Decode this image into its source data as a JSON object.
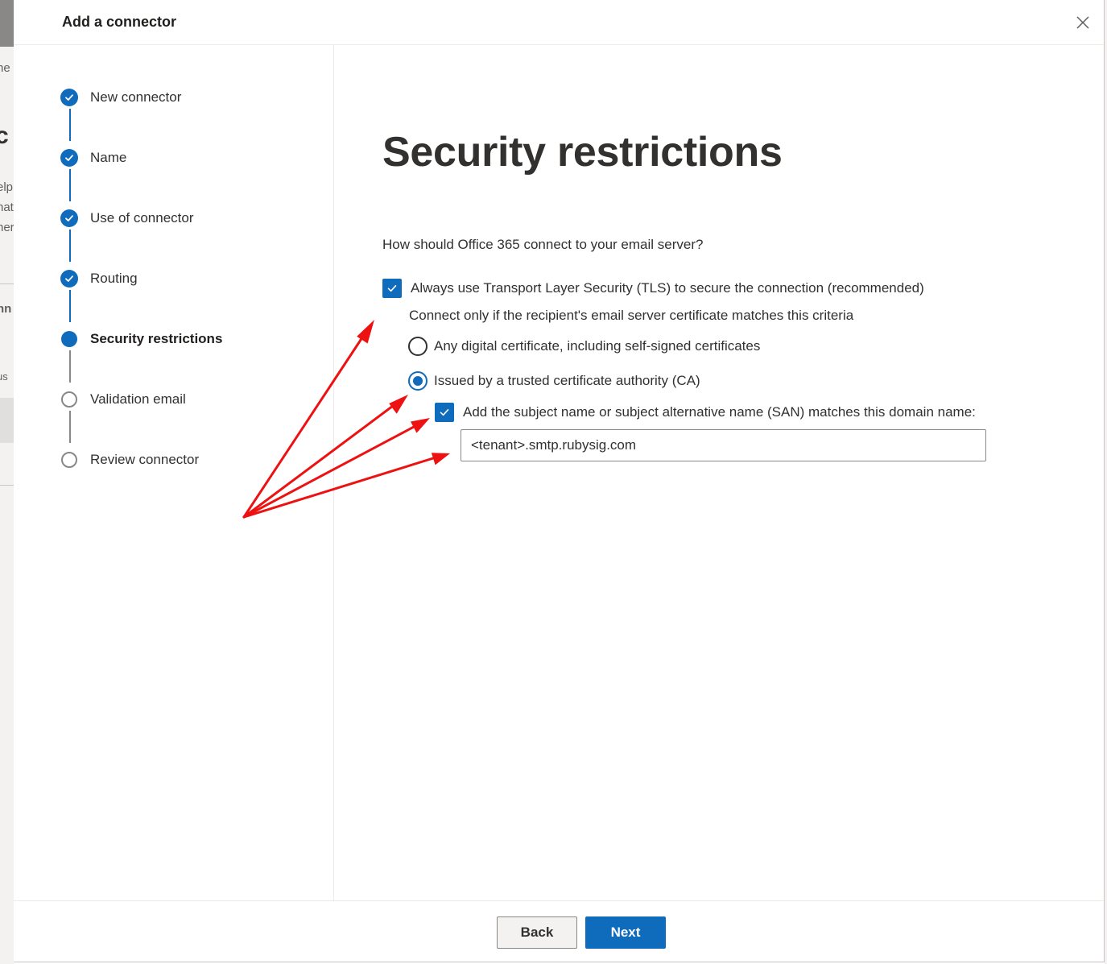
{
  "background": {
    "fragments": [
      "ne",
      "c",
      "elp",
      "nat",
      "her",
      "nn",
      "us"
    ]
  },
  "dialog": {
    "title": "Add a connector",
    "close_label": "Close"
  },
  "steps": [
    {
      "label": "New connector",
      "status": "completed"
    },
    {
      "label": "Name",
      "status": "completed"
    },
    {
      "label": "Use of connector",
      "status": "completed"
    },
    {
      "label": "Routing",
      "status": "completed"
    },
    {
      "label": "Security restrictions",
      "status": "current"
    },
    {
      "label": "Validation email",
      "status": "pending"
    },
    {
      "label": "Review connector",
      "status": "pending"
    }
  ],
  "content": {
    "title": "Security restrictions",
    "question": "How should Office 365 connect to your email server?",
    "tls_checkbox": {
      "label": "Always use Transport Layer Security (TLS) to secure the connection (recommended)",
      "checked": true
    },
    "criteria_text": "Connect only if the recipient's email server certificate matches this criteria",
    "radio_options": [
      {
        "label": "Any digital certificate, including self-signed certificates",
        "selected": false
      },
      {
        "label": "Issued by a trusted certificate authority (CA)",
        "selected": true
      }
    ],
    "san_checkbox": {
      "label": "Add the subject name or subject alternative name (SAN) matches this domain name:",
      "checked": true
    },
    "domain_input": {
      "value": "<tenant>.smtp.rubysig.com"
    }
  },
  "footer": {
    "back_label": "Back",
    "next_label": "Next"
  },
  "colors": {
    "accent": "#0f6cbd",
    "annotation_arrows": "#ee1111"
  },
  "icons": {
    "completed_step": "check-icon",
    "close": "close-icon"
  }
}
